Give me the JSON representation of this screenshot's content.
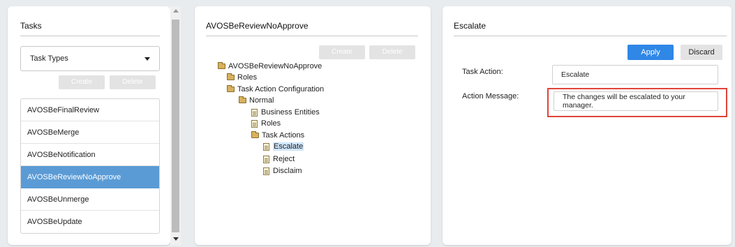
{
  "left_panel": {
    "title": "Tasks",
    "dropdown": {
      "value": "Task Types"
    },
    "create_label": "Create",
    "delete_label": "Delete",
    "tasks": [
      {
        "label": "AVOSBeFinalReview"
      },
      {
        "label": "AVOSBeMerge"
      },
      {
        "label": "AVOSBeNotification"
      },
      {
        "label": "AVOSBeReviewNoApprove",
        "selected": true
      },
      {
        "label": "AVOSBeUnmerge"
      },
      {
        "label": "AVOSBeUpdate"
      }
    ]
  },
  "middle_panel": {
    "title": "AVOSBeReviewNoApprove",
    "create_label": "Create",
    "delete_label": "Delete",
    "tree": [
      {
        "label": "AVOSBeReviewNoApprove",
        "icon": "folder-open-icon"
      },
      {
        "label": "Roles",
        "icon": "folder-icon"
      },
      {
        "label": "Task Action Configuration",
        "icon": "folder-open-icon"
      },
      {
        "label": "Normal",
        "icon": "folder-open-icon"
      },
      {
        "label": "Business Entities",
        "icon": "document-icon"
      },
      {
        "label": "Roles",
        "icon": "document-icon"
      },
      {
        "label": "Task Actions",
        "icon": "folder-open-icon"
      },
      {
        "label": "Escalate",
        "icon": "document-icon",
        "selected": true
      },
      {
        "label": "Reject",
        "icon": "document-icon"
      },
      {
        "label": "Disclaim",
        "icon": "document-icon"
      }
    ]
  },
  "right_panel": {
    "title": "Escalate",
    "apply_label": "Apply",
    "discard_label": "Discard",
    "task_action_label": "Task Action:",
    "task_action_value": "Escalate",
    "action_message_label": "Action Message:",
    "action_message_value": "The changes will be escalated to your manager."
  },
  "colors": {
    "accent": "#2f87e6",
    "selected_row": "#5b9bd5",
    "highlight_border": "#e0443a"
  }
}
